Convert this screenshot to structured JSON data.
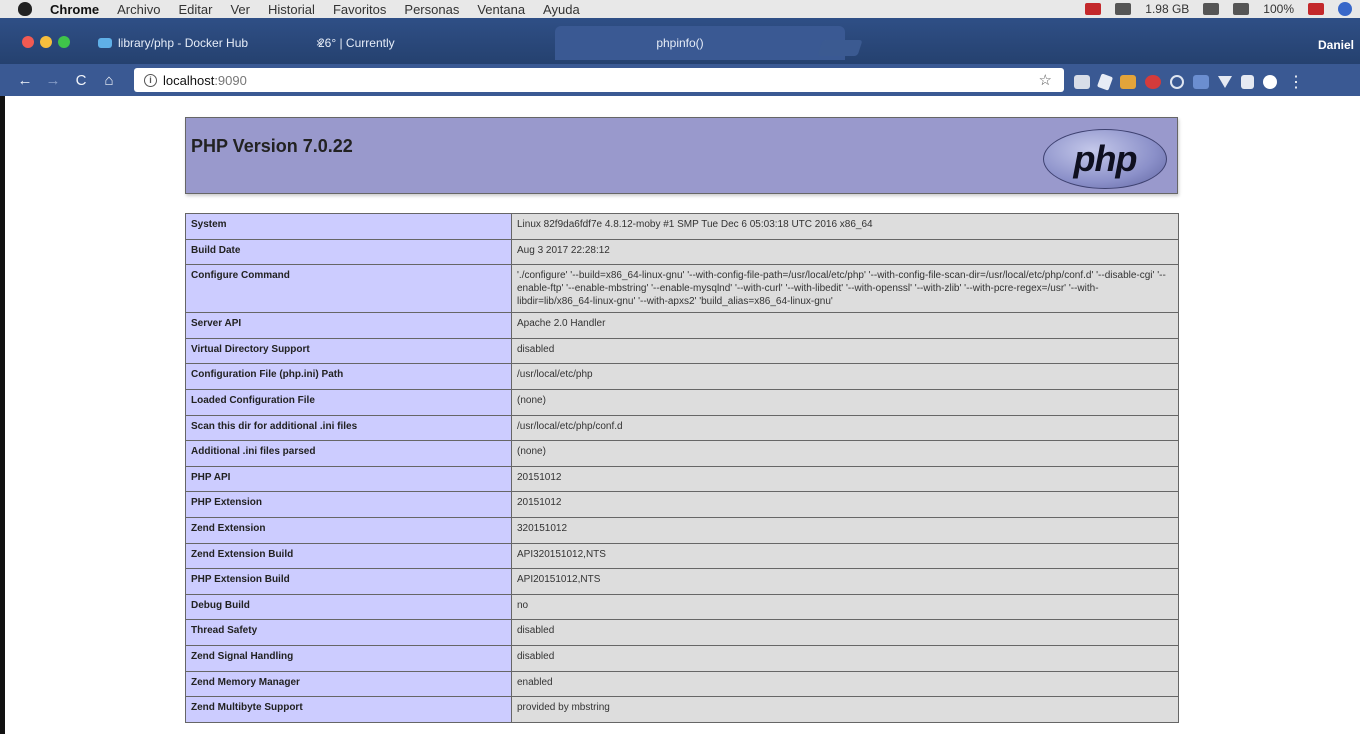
{
  "menubar": {
    "app": "Chrome",
    "items": [
      "Archivo",
      "Editar",
      "Ver",
      "Historial",
      "Favoritos",
      "Personas",
      "Ventana",
      "Ayuda"
    ],
    "storage": "1.98 GB",
    "battery": "100%"
  },
  "tabs": [
    {
      "label": "library/php - Docker Hub",
      "close": "×"
    },
    {
      "label": "26° | Currently",
      "close": "×"
    },
    {
      "label": "phpinfo()",
      "close": "×"
    }
  ],
  "profile": "Daniel",
  "toolbar": {
    "back": "←",
    "forward": "→",
    "reload": "C",
    "home": "⌂",
    "url_host": "localhost",
    "url_port": ":9090",
    "star": "☆",
    "menu": "⋮"
  },
  "phpinfo": {
    "version_title": "PHP Version 7.0.22",
    "logo_text": "php",
    "rows": [
      {
        "key": "System",
        "value": "Linux 82f9da6fdf7e 4.8.12-moby #1 SMP Tue Dec 6 05:03:18 UTC 2016 x86_64"
      },
      {
        "key": "Build Date",
        "value": "Aug 3 2017 22:28:12"
      },
      {
        "key": "Configure Command",
        "value": "'./configure' '--build=x86_64-linux-gnu' '--with-config-file-path=/usr/local/etc/php' '--with-config-file-scan-dir=/usr/local/etc/php/conf.d' '--disable-cgi' '--enable-ftp' '--enable-mbstring' '--enable-mysqlnd' '--with-curl' '--with-libedit' '--with-openssl' '--with-zlib' '--with-pcre-regex=/usr' '--with-libdir=lib/x86_64-linux-gnu' '--with-apxs2' 'build_alias=x86_64-linux-gnu'"
      },
      {
        "key": "Server API",
        "value": "Apache 2.0 Handler"
      },
      {
        "key": "Virtual Directory Support",
        "value": "disabled"
      },
      {
        "key": "Configuration File (php.ini) Path",
        "value": "/usr/local/etc/php"
      },
      {
        "key": "Loaded Configuration File",
        "value": "(none)"
      },
      {
        "key": "Scan this dir for additional .ini files",
        "value": "/usr/local/etc/php/conf.d"
      },
      {
        "key": "Additional .ini files parsed",
        "value": "(none)"
      },
      {
        "key": "PHP API",
        "value": "20151012"
      },
      {
        "key": "PHP Extension",
        "value": "20151012"
      },
      {
        "key": "Zend Extension",
        "value": "320151012"
      },
      {
        "key": "Zend Extension Build",
        "value": "API320151012,NTS"
      },
      {
        "key": "PHP Extension Build",
        "value": "API20151012,NTS"
      },
      {
        "key": "Debug Build",
        "value": "no"
      },
      {
        "key": "Thread Safety",
        "value": "disabled"
      },
      {
        "key": "Zend Signal Handling",
        "value": "disabled"
      },
      {
        "key": "Zend Memory Manager",
        "value": "enabled"
      },
      {
        "key": "Zend Multibyte Support",
        "value": "provided by mbstring"
      }
    ]
  }
}
